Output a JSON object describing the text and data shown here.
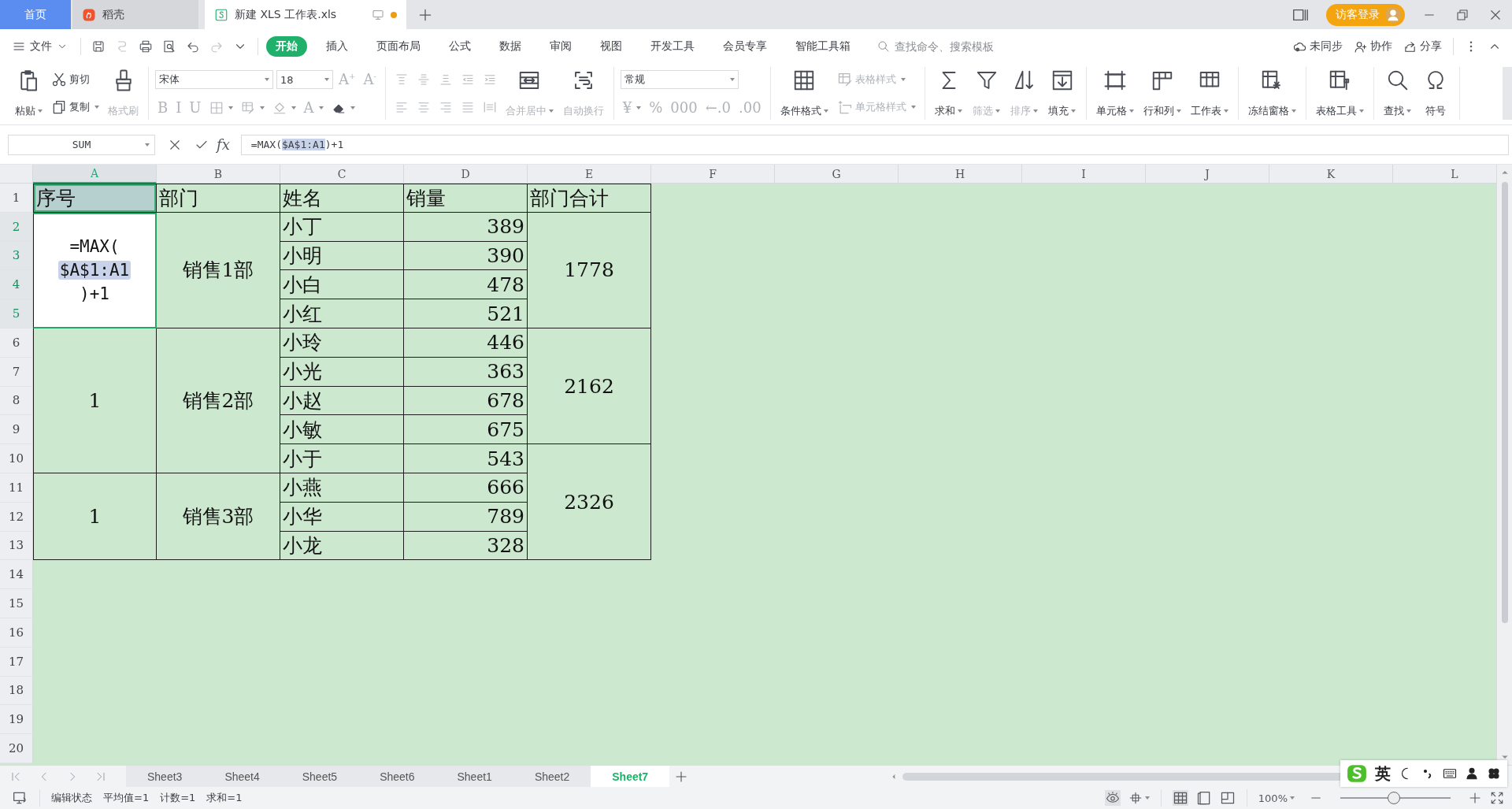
{
  "tabs": [
    {
      "label": "首页",
      "selected": false,
      "kind": "home"
    },
    {
      "label": "稻壳",
      "selected": false,
      "kind": "app"
    },
    {
      "label": "新建 XLS 工作表.xls",
      "selected": true,
      "kind": "doc",
      "unsaved": true
    }
  ],
  "account": {
    "label": "访客登录"
  },
  "menu": {
    "file": "文件",
    "tabs": [
      {
        "label": "开始",
        "selected": true
      },
      {
        "label": "插入",
        "selected": false
      },
      {
        "label": "页面布局",
        "selected": false
      },
      {
        "label": "公式",
        "selected": false
      },
      {
        "label": "数据",
        "selected": false
      },
      {
        "label": "审阅",
        "selected": false
      },
      {
        "label": "视图",
        "selected": false
      },
      {
        "label": "开发工具",
        "selected": false
      },
      {
        "label": "会员专享",
        "selected": false
      },
      {
        "label": "智能工具箱",
        "selected": false
      }
    ],
    "search": {
      "placeholder": "查找命令、搜索模板"
    },
    "actions": [
      "未同步",
      "协作",
      "分享"
    ]
  },
  "ribbon": [
    {
      "items": [
        {
          "kind": "large",
          "label": "粘贴",
          "dropdown": true,
          "disabled": false
        },
        {
          "kind": "stack",
          "top": [
            {
              "kind": "small",
              "label": "剪切",
              "dropdown": false,
              "disabled": false
            }
          ],
          "bottom": [
            {
              "kind": "small",
              "label": "复制",
              "dropdown": true,
              "disabled": false
            }
          ]
        },
        {
          "kind": "large",
          "label": "格式刷",
          "dropdown": false,
          "disabled": true
        }
      ]
    },
    {
      "items": [
        {
          "kind": "stack",
          "top": [
            {
              "kind": "field",
              "value": "宋体"
            },
            {
              "kind": "field",
              "value": "18"
            },
            {
              "kind": "glyph",
              "label": "A$^{+}$",
              "dropdown": false,
              "disabled": true
            },
            {
              "kind": "glyph",
              "label": "A$^{-}$",
              "dropdown": false,
              "disabled": true
            }
          ],
          "bottom": [
            {
              "kind": "glyph",
              "label": "B",
              "dropdown": false,
              "disabled": true
            },
            {
              "kind": "glyph",
              "label": "I",
              "dropdown": false,
              "disabled": true
            },
            {
              "kind": "glyph",
              "label": "U",
              "dropdown": false,
              "disabled": true
            },
            {
              "kind": "icon",
              "dropdown": true,
              "disabled": true
            },
            {
              "kind": "icon",
              "dropdown": true,
              "disabled": true
            },
            {
              "kind": "icon",
              "dropdown": true,
              "disabled": true
            },
            {
              "kind": "glyph",
              "label": "A",
              "dropdown": true,
              "disabled": true
            },
            {
              "kind": "icon",
              "dropdown": true,
              "disabled": false
            }
          ]
        }
      ]
    },
    {
      "items": [
        {
          "kind": "stack",
          "top": [
            {
              "kind": "icon",
              "dropdown": false,
              "disabled": true
            },
            {
              "kind": "icon",
              "dropdown": false,
              "disabled": true
            },
            {
              "kind": "icon",
              "dropdown": false,
              "disabled": true
            },
            {
              "kind": "icon",
              "dropdown": false,
              "disabled": true
            },
            {
              "kind": "icon",
              "dropdown": false,
              "disabled": true
            }
          ],
          "bottom": [
            {
              "kind": "icon",
              "dropdown": false,
              "disabled": true
            },
            {
              "kind": "icon",
              "dropdown": false,
              "disabled": true
            },
            {
              "kind": "icon",
              "dropdown": false,
              "disabled": true
            },
            {
              "kind": "icon",
              "dropdown": false,
              "disabled": true
            },
            {
              "kind": "icon",
              "dropdown": false,
              "disabled": true
            }
          ]
        },
        {
          "kind": "large",
          "label": "合并居中",
          "dropdown": true,
          "disabled": true
        },
        {
          "kind": "large",
          "label": "自动换行",
          "dropdown": false,
          "disabled": true
        }
      ]
    },
    {
      "items": [
        {
          "kind": "stack",
          "top": [
            {
              "kind": "field",
              "value": "常规"
            }
          ],
          "bottom": [
            {
              "kind": "glyph",
              "label": "¥",
              "dropdown": true,
              "disabled": true
            },
            {
              "kind": "glyph",
              "label": "%",
              "dropdown": false,
              "disabled": true
            },
            {
              "kind": "glyph",
              "label": "000",
              "dropdown": false,
              "disabled": true
            },
            {
              "kind": "glyph",
              "label": "←.0",
              "dropdown": false,
              "disabled": true
            },
            {
              "kind": "glyph",
              "label": ".00",
              "dropdown": false,
              "disabled": true
            }
          ]
        }
      ]
    },
    {
      "items": [
        {
          "kind": "large",
          "label": "条件格式",
          "dropdown": true,
          "disabled": false
        },
        {
          "kind": "stack",
          "top": [
            {
              "kind": "small",
              "label": "表格样式",
              "dropdown": true,
              "disabled": true
            }
          ],
          "bottom": [
            {
              "kind": "small",
              "label": "单元格样式",
              "dropdown": true,
              "disabled": true
            }
          ]
        }
      ]
    },
    {
      "items": [
        {
          "kind": "large",
          "label": "求和",
          "dropdown": true,
          "disabled": false
        },
        {
          "kind": "large",
          "label": "筛选",
          "dropdown": true,
          "disabled": true
        },
        {
          "kind": "large",
          "label": "排序",
          "dropdown": true,
          "disabled": true
        },
        {
          "kind": "large",
          "label": "填充",
          "dropdown": true,
          "disabled": false
        }
      ]
    },
    {
      "items": [
        {
          "kind": "large",
          "label": "单元格",
          "dropdown": true,
          "disabled": false
        },
        {
          "kind": "large",
          "label": "行和列",
          "dropdown": true,
          "disabled": false
        },
        {
          "kind": "large",
          "label": "工作表",
          "dropdown": true,
          "disabled": false
        }
      ]
    },
    {
      "items": [
        {
          "kind": "large",
          "label": "冻结窗格",
          "dropdown": true,
          "disabled": false
        }
      ]
    },
    {
      "items": [
        {
          "kind": "large",
          "label": "表格工具",
          "dropdown": true,
          "disabled": false
        }
      ]
    },
    {
      "items": [
        {
          "kind": "large",
          "label": "查找",
          "dropdown": true,
          "disabled": false
        },
        {
          "kind": "large",
          "label": "符号",
          "dropdown": false,
          "disabled": false
        }
      ]
    }
  ],
  "formula_bar": {
    "name_box": "SUM",
    "function_label": "fx",
    "formula": [
      {
        "text": "=MAX(",
        "highlighted": false
      },
      {
        "text": "$A$1:A1",
        "highlighted": true
      },
      {
        "text": ")+1",
        "highlighted": false
      }
    ]
  },
  "sheet": {
    "columns": [
      {
        "label": "A",
        "selected": true
      },
      {
        "label": "B",
        "selected": false
      },
      {
        "label": "C",
        "selected": false
      },
      {
        "label": "D",
        "selected": false
      },
      {
        "label": "E",
        "selected": false
      },
      {
        "label": "F",
        "selected": false
      },
      {
        "label": "G",
        "selected": false
      },
      {
        "label": "H",
        "selected": false
      },
      {
        "label": "I",
        "selected": false
      },
      {
        "label": "J",
        "selected": false
      },
      {
        "label": "K",
        "selected": false
      },
      {
        "label": "L",
        "selected": false
      }
    ],
    "rows": [
      {
        "label": "1",
        "selected": false,
        "cells": [
          {
            "kind": "text",
            "text": "序号",
            "referenced": true
          },
          {
            "kind": "text",
            "text": "部门",
            "referenced": false
          },
          {
            "kind": "text",
            "text": "姓名",
            "referenced": false
          },
          {
            "kind": "text",
            "text": "销量",
            "referenced": false
          },
          {
            "kind": "text",
            "text": "部门合计",
            "referenced": false
          }
        ]
      },
      {
        "label": "2",
        "selected": true,
        "cells": [
          {
            "kind": "editing",
            "rowspan": 4,
            "parts": [
              {
                "text": "=MAX(",
                "highlighted": false
              },
              {
                "text": "$A$1:A1",
                "highlighted": true
              },
              {
                "text": ")+1",
                "highlighted": false
              }
            ]
          },
          {
            "kind": "merged",
            "rowspan": 4,
            "text": "销售1部",
            "referenced": false
          },
          {
            "kind": "text",
            "text": "小丁",
            "referenced": false
          },
          {
            "kind": "number",
            "text": "389",
            "referenced": false
          },
          {
            "kind": "merged",
            "rowspan": 4,
            "text": "1778",
            "referenced": false
          }
        ]
      },
      {
        "label": "3",
        "selected": true,
        "cells": [
          {
            "kind": "text",
            "text": "小明",
            "referenced": false
          },
          {
            "kind": "number",
            "text": "390",
            "referenced": false
          }
        ]
      },
      {
        "label": "4",
        "selected": true,
        "cells": [
          {
            "kind": "text",
            "text": "小白",
            "referenced": false
          },
          {
            "kind": "number",
            "text": "478",
            "referenced": false
          }
        ]
      },
      {
        "label": "5",
        "selected": true,
        "cells": [
          {
            "kind": "text",
            "text": "小红",
            "referenced": false
          },
          {
            "kind": "number",
            "text": "521",
            "referenced": false
          }
        ]
      },
      {
        "label": "6",
        "selected": false,
        "cells": [
          {
            "kind": "merged",
            "rowspan": 5,
            "text": "1",
            "referenced": false
          },
          {
            "kind": "merged",
            "rowspan": 5,
            "text": "销售2部",
            "referenced": false
          },
          {
            "kind": "text",
            "text": "小玲",
            "referenced": false
          },
          {
            "kind": "number",
            "text": "446",
            "referenced": false
          },
          {
            "kind": "merged",
            "rowspan": 4,
            "text": "2162",
            "referenced": false
          }
        ]
      },
      {
        "label": "7",
        "selected": false,
        "cells": [
          {
            "kind": "text",
            "text": "小光",
            "referenced": false
          },
          {
            "kind": "number",
            "text": "363",
            "referenced": false
          }
        ]
      },
      {
        "label": "8",
        "selected": false,
        "cells": [
          {
            "kind": "text",
            "text": "小赵",
            "referenced": false
          },
          {
            "kind": "number",
            "text": "678",
            "referenced": false
          }
        ]
      },
      {
        "label": "9",
        "selected": false,
        "cells": [
          {
            "kind": "text",
            "text": "小敏",
            "referenced": false
          },
          {
            "kind": "number",
            "text": "675",
            "referenced": false
          }
        ]
      },
      {
        "label": "10",
        "selected": false,
        "cells": [
          {
            "kind": "text",
            "text": "小于",
            "referenced": false
          },
          {
            "kind": "number",
            "text": "543",
            "referenced": false
          },
          {
            "kind": "merged",
            "rowspan": 4,
            "text": "2326",
            "referenced": false
          }
        ]
      },
      {
        "label": "11",
        "selected": false,
        "cells": [
          {
            "kind": "merged",
            "rowspan": 3,
            "text": "1",
            "referenced": false
          },
          {
            "kind": "merged",
            "rowspan": 3,
            "text": "销售3部",
            "referenced": false
          },
          {
            "kind": "text",
            "text": "小燕",
            "referenced": false
          },
          {
            "kind": "number",
            "text": "666",
            "referenced": false
          }
        ]
      },
      {
        "label": "12",
        "selected": false,
        "cells": [
          {
            "kind": "text",
            "text": "小华",
            "referenced": false
          },
          {
            "kind": "number",
            "text": "789",
            "referenced": false
          }
        ]
      },
      {
        "label": "13",
        "selected": false,
        "cells": [
          {
            "kind": "text",
            "text": "小龙",
            "referenced": false
          },
          {
            "kind": "number",
            "text": "328",
            "referenced": false
          }
        ]
      },
      {
        "label": "14",
        "selected": false
      },
      {
        "label": "15",
        "selected": false
      },
      {
        "label": "16",
        "selected": false
      },
      {
        "label": "17",
        "selected": false
      },
      {
        "label": "18",
        "selected": false
      },
      {
        "label": "19",
        "selected": false
      },
      {
        "label": "20",
        "selected": false
      }
    ]
  },
  "sheet_tabs": [
    {
      "label": "Sheet3",
      "selected": false
    },
    {
      "label": "Sheet4",
      "selected": false
    },
    {
      "label": "Sheet5",
      "selected": false
    },
    {
      "label": "Sheet6",
      "selected": false
    },
    {
      "label": "Sheet1",
      "selected": false
    },
    {
      "label": "Sheet2",
      "selected": false
    },
    {
      "label": "Sheet7",
      "selected": true
    }
  ],
  "status_bar": {
    "mode": "编辑状态",
    "stats": [
      "平均值=1",
      "计数=1",
      "求和=1"
    ],
    "views": [
      {
        "selected": true
      },
      {
        "selected": false
      },
      {
        "selected": false
      }
    ],
    "zoom": "100%",
    "zoom_slider": {
      "level": 0.49
    }
  },
  "ime": {
    "label": "英"
  }
}
